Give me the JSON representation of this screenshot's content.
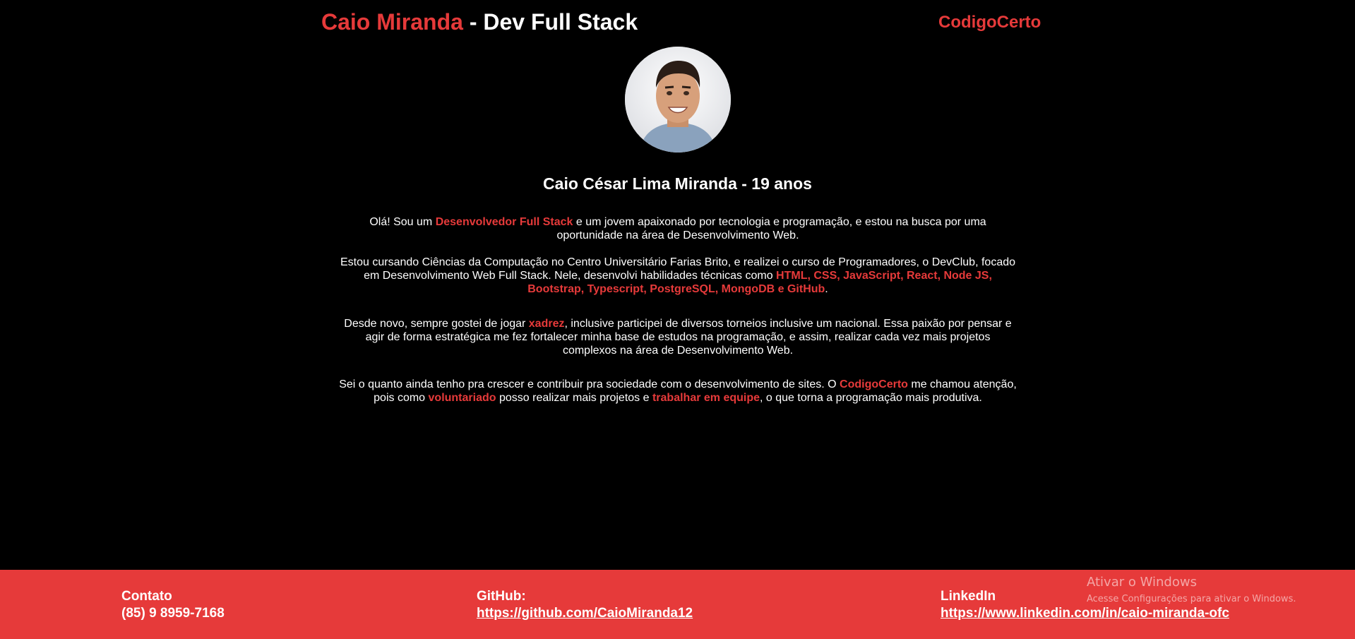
{
  "header": {
    "name_highlight": "Caio Miranda",
    "separator": " - ",
    "role": "Dev Full Stack",
    "site_link": "CodigoCerto"
  },
  "profile": {
    "photo_alt": "Caio Miranda",
    "title": "Caio César Lima Miranda - 19 anos"
  },
  "bio": {
    "p1": {
      "a": "Olá! Sou um ",
      "b": "Desenvolvedor Full Stack",
      "c": " e um jovem apaixonado por tecnologia e programação, e estou na busca por uma oportunidade na área de Desenvolvimento Web."
    },
    "p2": {
      "a": "Estou cursando Ciências da Computação no Centro Universitário Farias Brito, e realizei o curso de Programadores, o DevClub, focado em Desenvolvimento Web Full Stack. Nele, desenvolvi habilidades técnicas como ",
      "b": "HTML, CSS, JavaScript, React, Node JS, Bootstrap, Typescript, PostgreSQL, MongoDB e GitHub",
      "c": "."
    },
    "p3": {
      "a": "Desde novo, sempre gostei de jogar ",
      "b": "xadrez",
      "c": ", inclusive participei de diversos torneios inclusive um nacional. Essa paixão por pensar e agir de forma estratégica me fez fortalecer minha base de estudos na programação, e assim, realizar cada vez mais projetos complexos na área de Desenvolvimento Web."
    },
    "p4": {
      "a": "Sei o quanto ainda tenho pra crescer e contribuir pra sociedade com o desenvolvimento de sites. O ",
      "b": "CodigoCerto",
      "c": " me chamou atenção, pois como ",
      "d": "voluntariado",
      "e": " posso realizar mais projetos e ",
      "f": "trabalhar em equipe",
      "g": ", o que torna a programação mais produtiva."
    }
  },
  "footer": {
    "contact_title": "Contato",
    "contact_phone": "(85) 9 8959-7168",
    "github_title": "GitHub:",
    "github_url": "https://github.com/CaioMiranda12",
    "linkedin_title": "LinkedIn",
    "linkedin_url": "https://www.linkedin.com/in/caio-miranda-ofc"
  },
  "watermark": {
    "line1": "Ativar o Windows",
    "line2": "Acesse Configurações para ativar o Windows."
  },
  "colors": {
    "accent": "#e63a3a",
    "background": "#000000",
    "text": "#ffffff"
  }
}
